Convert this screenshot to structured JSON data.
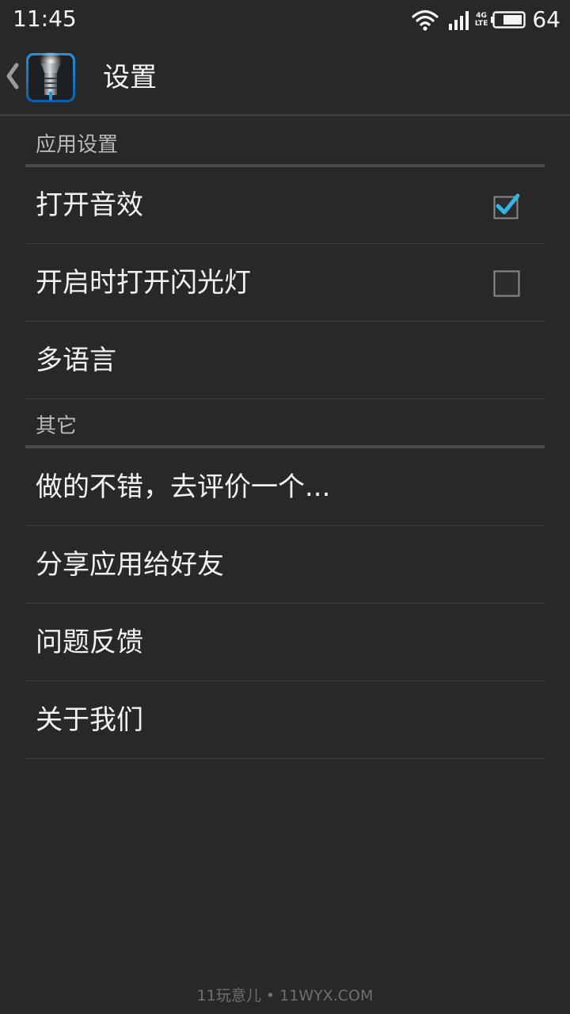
{
  "status_bar": {
    "time": "11:45",
    "network": "4G",
    "network_sub": "LTE",
    "battery": "64",
    "icons": [
      "wifi-icon",
      "cell-signal-icon",
      "battery-icon"
    ]
  },
  "action_bar": {
    "title": "设置",
    "back_icon": "chevron-left-icon",
    "app_icon": "flashlight-app-icon"
  },
  "sections": {
    "app_settings": {
      "header": "应用设置",
      "items": [
        {
          "label": "打开音效",
          "checkbox": true,
          "checked": true
        },
        {
          "label": "开启时打开闪光灯",
          "checkbox": true,
          "checked": false
        },
        {
          "label": "多语言"
        }
      ]
    },
    "other": {
      "header": "其它",
      "items": [
        {
          "label": "做的不错，去评价一个..."
        },
        {
          "label": "分享应用给好友"
        },
        {
          "label": "问题反馈"
        },
        {
          "label": "关于我们"
        }
      ]
    }
  },
  "watermark": "11玩意儿 • 11WYX.COM",
  "colors": {
    "background": "#282828",
    "divider": "#3d3d3d",
    "accent": "#33b5e5",
    "text": "#f2f2f2",
    "section_text": "#b9b9b9"
  }
}
